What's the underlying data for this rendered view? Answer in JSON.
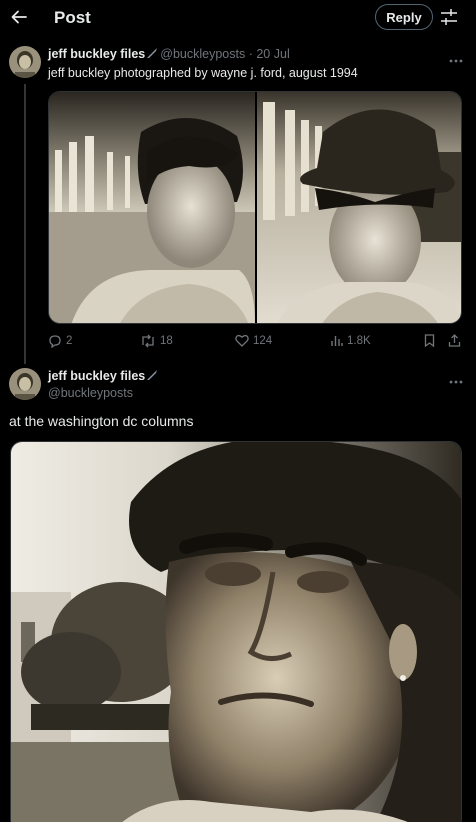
{
  "header": {
    "title": "Post",
    "reply_label": "Reply",
    "back_icon": "arrow-left-icon",
    "settings_icon": "sliders-icon"
  },
  "tweets": [
    {
      "display_name": "jeff buckley files",
      "handle": "@buckleyposts",
      "separator": "·",
      "date": "20 Jul",
      "text": "jeff buckley photographed by wayne j. ford, august 1994",
      "badge_icon": "quill-pen-icon",
      "stats": {
        "replies": "2",
        "reposts": "18",
        "likes": "124",
        "views": "1.8K"
      }
    },
    {
      "display_name": "jeff buckley files",
      "handle": "@buckleyposts",
      "text": "at the washington dc columns",
      "badge_icon": "quill-pen-icon"
    }
  ],
  "colors": {
    "background": "#000000",
    "text_primary": "#e7e9ea",
    "text_secondary": "#71767b",
    "border": "#2f3336"
  }
}
